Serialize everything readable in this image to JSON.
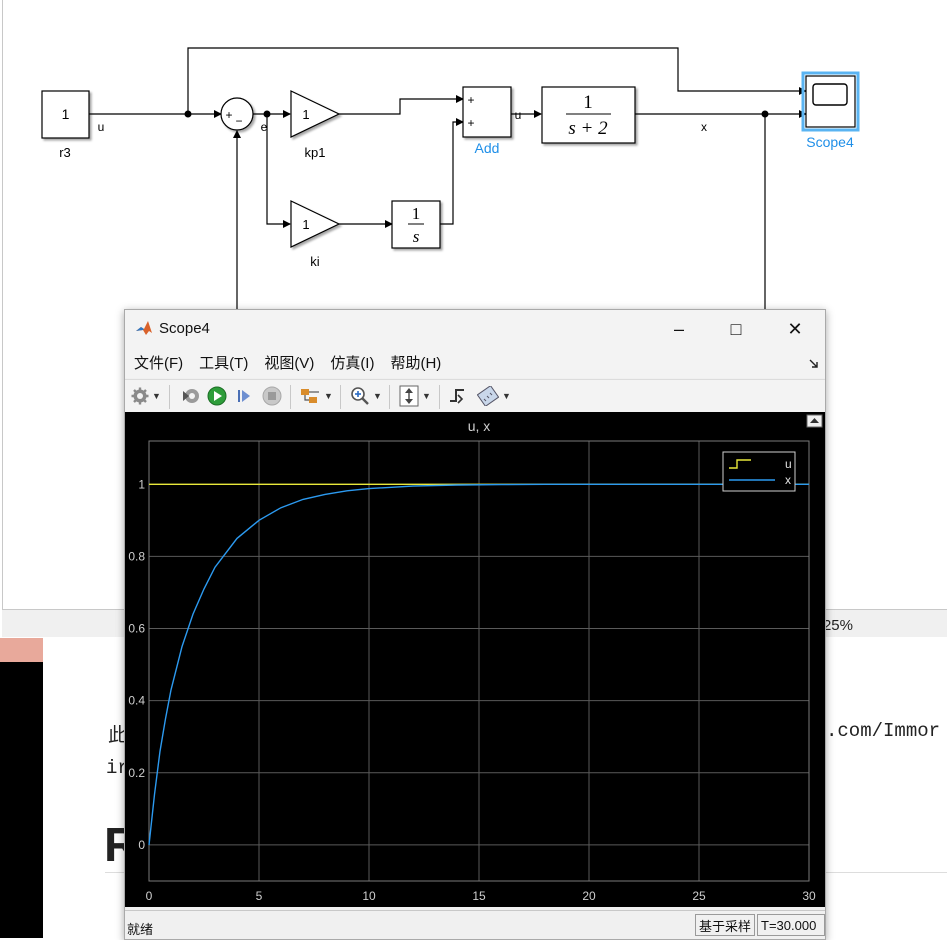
{
  "background": {
    "zoom_percent": "125%",
    "text_line1_prefix": "此",
    "text_line1_url": ".com/Immor",
    "text_line2": "ir",
    "text_big": "R"
  },
  "diagram": {
    "blocks": {
      "r3": {
        "value": "1",
        "name": "r3"
      },
      "sum": {
        "plus": "+",
        "minus": "−"
      },
      "kp1": {
        "value": "1",
        "name": "kp1"
      },
      "ki": {
        "value": "1",
        "name": "ki"
      },
      "integrator": {
        "num": "1",
        "den": "s"
      },
      "add": {
        "name": "Add",
        "in1": "+",
        "in2": "+"
      },
      "transfer": {
        "num": "1",
        "den": "s + 2"
      },
      "scope": {
        "name": "Scope4"
      }
    },
    "signals": {
      "u1": "u",
      "e": "e",
      "u2": "u",
      "x": "x"
    }
  },
  "scope_window": {
    "title": "Scope4",
    "controls": {
      "minimize": "–",
      "maximize": "□",
      "close": "✕"
    },
    "menu": [
      "文件(F)",
      "工具(T)",
      "视图(V)",
      "仿真(I)",
      "帮助(H)"
    ],
    "toolbar_icons": [
      "gear-icon",
      "restore-icon",
      "run-icon",
      "step-forward-icon",
      "stop-icon",
      "signal-select-icon",
      "zoom-icon",
      "scale-axes-icon",
      "triggers-icon",
      "measurements-icon"
    ],
    "status": {
      "ready": "就绪",
      "sample_based": "基于采样",
      "time": "T=30.000"
    },
    "colors": {
      "u": "#e8e83a",
      "x": "#2c9af0",
      "background": "#000000",
      "grid": "#5a5a5a"
    }
  },
  "chart_data": {
    "type": "line",
    "title": "u, x",
    "xlabel": "",
    "ylabel": "",
    "xlim": [
      0,
      30
    ],
    "ylim": [
      -0.1,
      1.12
    ],
    "xticks": [
      0,
      5,
      10,
      15,
      20,
      25,
      30
    ],
    "yticks": [
      0,
      0.2,
      0.4,
      0.6,
      0.8,
      1
    ],
    "grid": true,
    "legend_position": "top-right",
    "series": [
      {
        "name": "u",
        "color": "#e8e83a",
        "x": [
          0,
          30
        ],
        "y": [
          1,
          1
        ]
      },
      {
        "name": "x",
        "color": "#2c9af0",
        "x": [
          0,
          0.25,
          0.5,
          0.75,
          1,
          1.5,
          2,
          2.5,
          3,
          4,
          5,
          6,
          7,
          8,
          9,
          10,
          12,
          14,
          16,
          18,
          20,
          25,
          30
        ],
        "y": [
          0,
          0.14,
          0.26,
          0.35,
          0.43,
          0.55,
          0.64,
          0.71,
          0.77,
          0.85,
          0.9,
          0.935,
          0.958,
          0.972,
          0.982,
          0.988,
          0.995,
          0.998,
          0.999,
          1.0,
          1.0,
          1.0,
          1.0
        ]
      }
    ]
  }
}
